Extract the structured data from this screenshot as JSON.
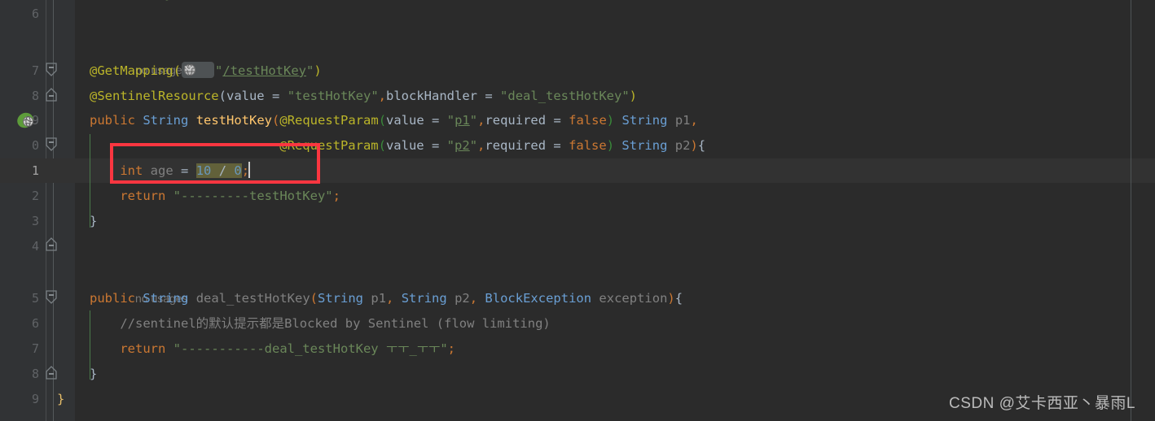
{
  "editor": {
    "theme": "darcula",
    "background": "#2b2b2b",
    "gutter_background": "#313335",
    "current_line_background": "#323232",
    "selection_color": "#62613a",
    "highlight_box_color": "#fb3640"
  },
  "gutter": {
    "line_numbers": [
      "6",
      "7",
      "8",
      "9",
      "0",
      "1",
      "2",
      "3",
      "4",
      "5",
      "6",
      "7",
      "8",
      "9"
    ],
    "current_line_number": "1",
    "spring_icon_name": "spring-bean-globe-icon"
  },
  "code_lines": [
    {
      "n": 0,
      "kind": "blank",
      "text": ""
    },
    {
      "n": 1,
      "kind": "usage",
      "text": "no usages"
    },
    {
      "n": 2,
      "kind": "code",
      "text": "@GetMapping(\"/testHotKey\")"
    },
    {
      "n": 3,
      "kind": "code",
      "text": "@SentinelResource(value = \"testHotKey\",blockHandler = \"deal_testHotKey\")"
    },
    {
      "n": 4,
      "kind": "code",
      "text": "public String testHotKey(@RequestParam(value = \"p1\",required = false) String p1,"
    },
    {
      "n": 5,
      "kind": "code",
      "text": "                         @RequestParam(value = \"p2\",required = false) String p2){"
    },
    {
      "n": 6,
      "kind": "code",
      "text": "    int age = 10 / 0;"
    },
    {
      "n": 7,
      "kind": "code",
      "text": "    return \"---------testHotKey\";"
    },
    {
      "n": 8,
      "kind": "code",
      "text": "}"
    },
    {
      "n": 9,
      "kind": "blank",
      "text": ""
    },
    {
      "n": 10,
      "kind": "usage",
      "text": "no usages"
    },
    {
      "n": 11,
      "kind": "code",
      "text": "public String deal_testHotKey(String p1, String p2, BlockException exception){"
    },
    {
      "n": 12,
      "kind": "code",
      "text": "    //sentinel的默认提示都是Blocked by Sentinel (flow limiting)"
    },
    {
      "n": 13,
      "kind": "code",
      "text": "    return \"-----------deal_testHotKey ㅜㅜ_ㅜㅜ\";"
    },
    {
      "n": 14,
      "kind": "code",
      "text": "}"
    },
    {
      "n": 15,
      "kind": "code",
      "text": "}"
    }
  ],
  "tokens": {
    "usages_label": "no usages",
    "at_getmapping": "@GetMapping",
    "paren_open": "(",
    "paren_close": ")",
    "mapping_path": "\"/testHotKey\"",
    "mapping_path_quote_open": "\"",
    "mapping_path_text": "/testHotKey",
    "mapping_path_quote_close": "\"",
    "at_sentinelresource": "@SentinelResource",
    "value_key": "value",
    "eq": "=",
    "sentinel_value": "\"testHotKey\"",
    "comma": ",",
    "blockhandler_key": "blockHandler",
    "blockhandler_value": "\"deal_testHotKey\"",
    "kw_public": "public",
    "type_string": "String",
    "method_testhotkey": "testHotKey",
    "at_requestparam": "@RequestParam",
    "p1_quote": "\"",
    "p1_text": "p1",
    "p2_text": "p2",
    "required_key": "required",
    "kw_false": "false",
    "param_p1": "p1",
    "param_p2": "p2",
    "brace_open": "{",
    "brace_close": "}",
    "kw_int": "int",
    "var_age": "age",
    "num_10": "10",
    "op_div": "/",
    "num_0": "0",
    "semicolon": ";",
    "kw_return": "return",
    "str_testhotkey": "\"---------testHotKey\"",
    "method_deal": "deal_testHotKey",
    "type_blockexception": "BlockException",
    "param_exception": "exception",
    "comment_sentinel": "//sentinel的默认提示都是Blocked by Sentinel (flow limiting)",
    "str_deal": "\"-----------deal_testHotKey ㅜㅜ_ㅜㅜ\""
  },
  "icons": {
    "globe_mapping": "globe-icon",
    "chevron_down": "chevron-down-icon",
    "fold_collapse": "fold-collapse-icon",
    "fold_expand": "fold-expand-icon",
    "spring_bean": "spring-bean-icon"
  },
  "watermark": {
    "text": "CSDN @艾卡西亚丶暴雨L"
  }
}
